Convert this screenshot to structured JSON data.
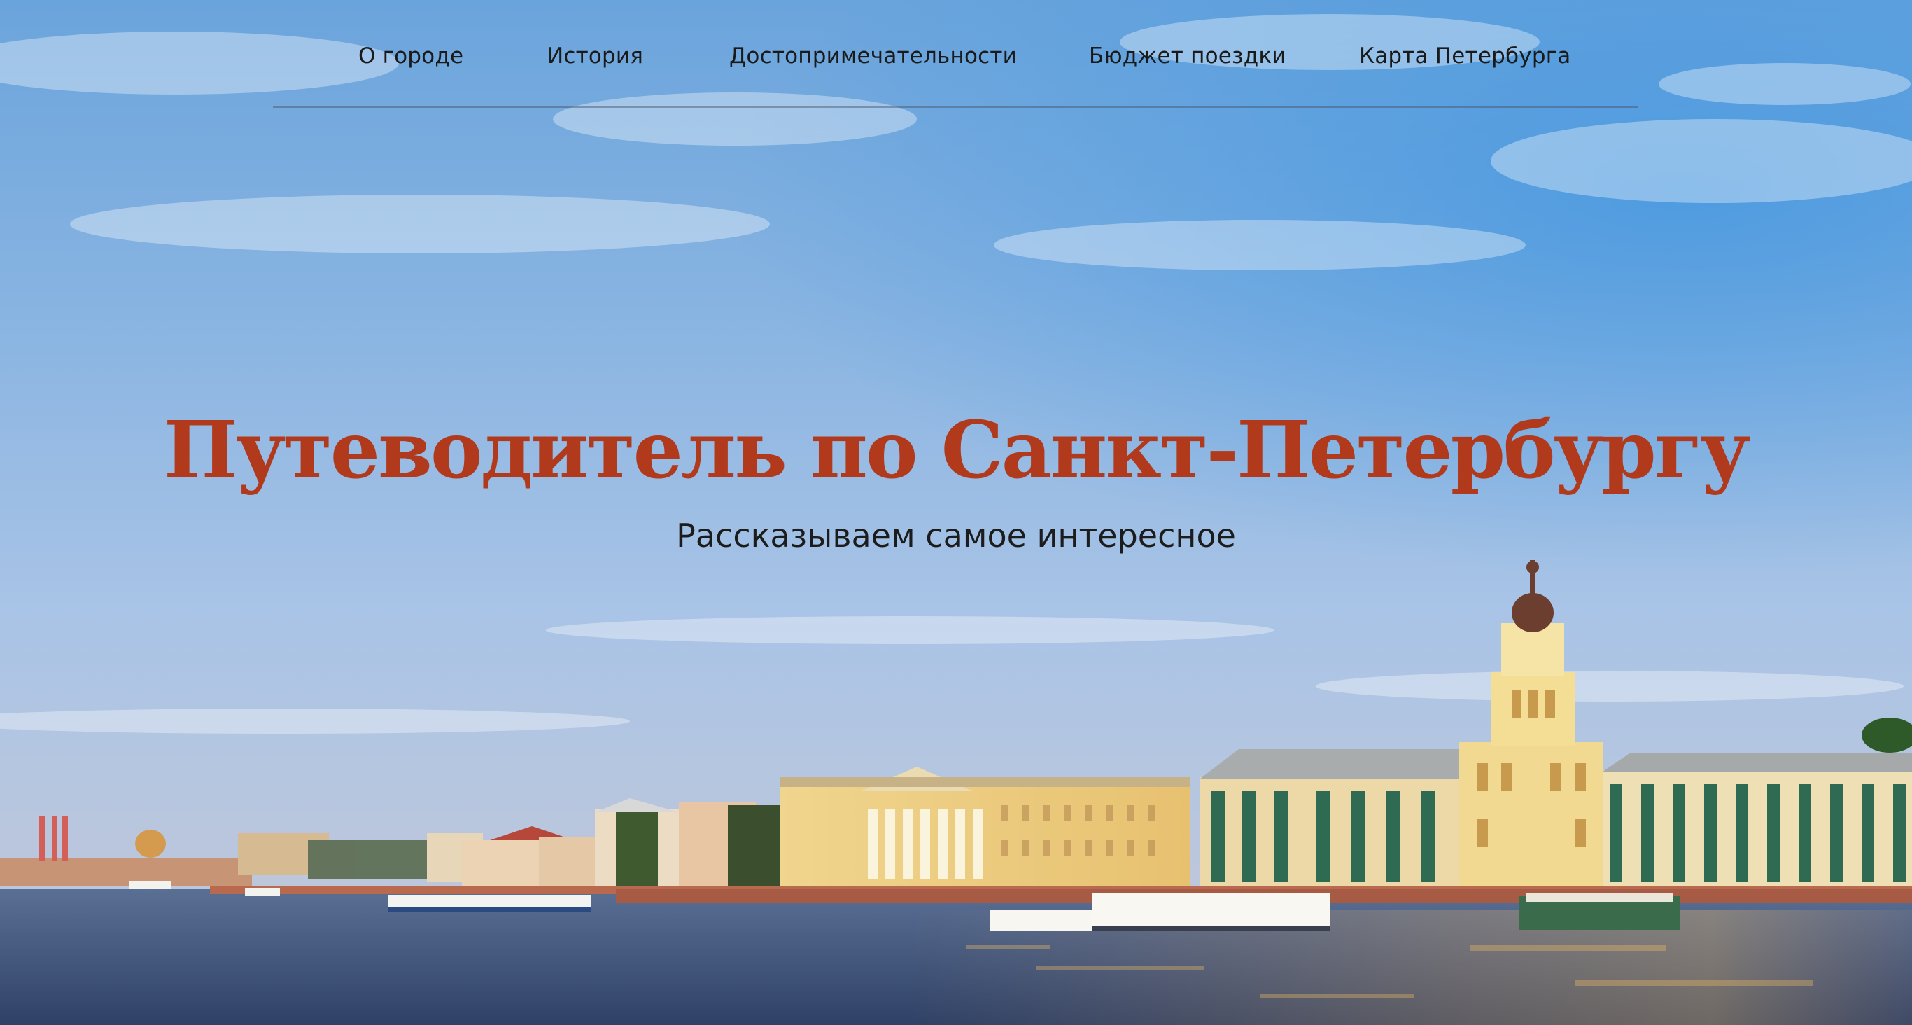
{
  "nav": {
    "items": [
      {
        "label": "О городе"
      },
      {
        "label": "История"
      },
      {
        "label": "Достопримечательности"
      },
      {
        "label": "Бюджет поездки"
      },
      {
        "label": "Карта Петербурга"
      }
    ]
  },
  "hero": {
    "title": "Путеводитель по Санкт-Петербургу",
    "subtitle": "Рассказываем самое интересное",
    "image": "st-petersburg-embankment-photo"
  },
  "colors": {
    "title": "#b23a1c",
    "nav_text": "#1a1a1a",
    "sky": "#7fb2e6",
    "water": "#3d5377"
  }
}
